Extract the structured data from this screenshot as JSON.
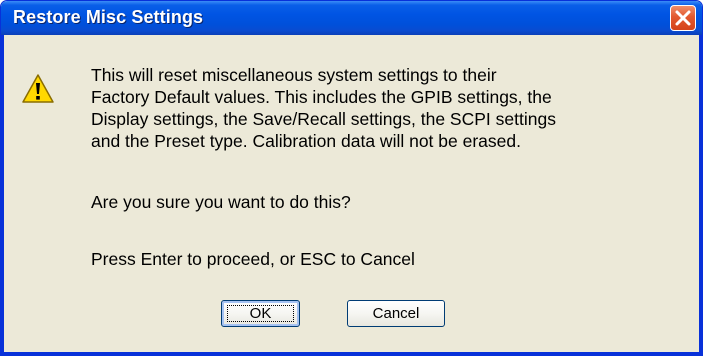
{
  "dialog": {
    "title": "Restore Misc Settings",
    "close_icon": "close-icon",
    "warning_icon": "warning-icon",
    "message_lines": [
      "This will reset miscellaneous system settings to their",
      "Factory Default values.   This includes the GPIB settings, the",
      "Display settings, the Save/Recall settings, the SCPI settings",
      "and the Preset type. Calibration data will not be erased."
    ],
    "question": "Are you sure you want to do this?",
    "instruction": "Press Enter to proceed, or ESC to Cancel",
    "ok_label": "OK",
    "cancel_label": "Cancel"
  },
  "colors": {
    "titlebar": "#0054e3",
    "close_button": "#e2592f",
    "dialog_background": "#ece9d8",
    "warning_yellow": "#ffd800"
  }
}
